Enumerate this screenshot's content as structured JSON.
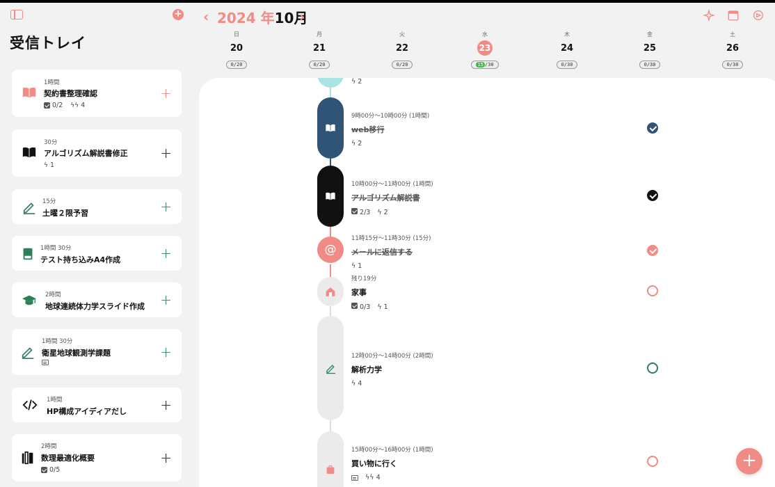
{
  "header": {
    "year": "2024 年",
    "month": "10月",
    "prev": "‹",
    "next": "›"
  },
  "sidebar": {
    "title": "受信トレイ",
    "add": "+",
    "items": [
      {
        "duration": "1時間",
        "title": "契約書整理確認",
        "check": "0/2",
        "energy": "4",
        "icon": "book-open-icon",
        "color": "#f08b86"
      },
      {
        "duration": "30分",
        "title": "アルゴリズム解説書修正",
        "energy": "1",
        "icon": "book-open-icon",
        "color": "#111111"
      },
      {
        "duration": "15分",
        "title": "土曜２限予習",
        "icon": "pencil-icon",
        "color": "#2e7d5b"
      },
      {
        "duration": "1時間 30分",
        "title": "テスト持ち込みA4作成",
        "icon": "notebook-icon",
        "color": "#2e7d5b"
      },
      {
        "duration": "2時間",
        "title": "地球連続体力学スライド作成",
        "icon": "graduation-cap-icon",
        "color": "#2e7d5b"
      },
      {
        "duration": "1時間 30分",
        "title": "衛星地球観測学課題",
        "icon": "pencil-icon",
        "color": "#2e7d5b"
      },
      {
        "duration": "1時間",
        "title": "HP構成アイディアだし",
        "icon": "code-icon",
        "color": "#111111"
      },
      {
        "duration": "2時間",
        "title": "数理最適化概要",
        "check": "0/5",
        "icon": "books-icon",
        "color": "#111111"
      }
    ]
  },
  "week": [
    {
      "weekday": "日",
      "date": "20",
      "count": "0/20"
    },
    {
      "weekday": "月",
      "date": "21",
      "count": "0/20"
    },
    {
      "weekday": "火",
      "date": "22",
      "count": "0/20"
    },
    {
      "weekday": "水",
      "date": "23",
      "count_done": "15",
      "count_total": "/30",
      "today": true
    },
    {
      "weekday": "木",
      "date": "24",
      "count": "0/30"
    },
    {
      "weekday": "金",
      "date": "25",
      "count": "0/30"
    },
    {
      "weekday": "土",
      "date": "26",
      "count": "0/30"
    }
  ],
  "timeline": [
    {
      "energy": "2",
      "color": "#a9e3e3"
    },
    {
      "time": "9時00分～10時00分 (1時間)",
      "title": "web移行",
      "energy": "2",
      "done": true,
      "color": "#2f5475"
    },
    {
      "time": "10時00分～11時00分 (1時間)",
      "title": "アルゴリズム解説書",
      "check": "2/3",
      "energy": "2",
      "done": true,
      "color": "#111111"
    },
    {
      "time": "11時15分～11時30分 (15分)",
      "title": "メールに返信する",
      "energy": "1",
      "done": true,
      "color": "#f08b86"
    },
    {
      "time": "残り19分",
      "title": "家事",
      "check": "0/3",
      "energy": "1",
      "done": false,
      "color": "#f08b86"
    },
    {
      "time": "12時00分～14時00分 (2時間)",
      "title": "解析力学",
      "energy": "4",
      "done": false,
      "color": "#2e7d5b"
    },
    {
      "time": "15時00分～16時00分 (1時間)",
      "title": "買い物に行く",
      "energy": "4",
      "done": false,
      "color": "#f08b86"
    }
  ],
  "fab": "+"
}
